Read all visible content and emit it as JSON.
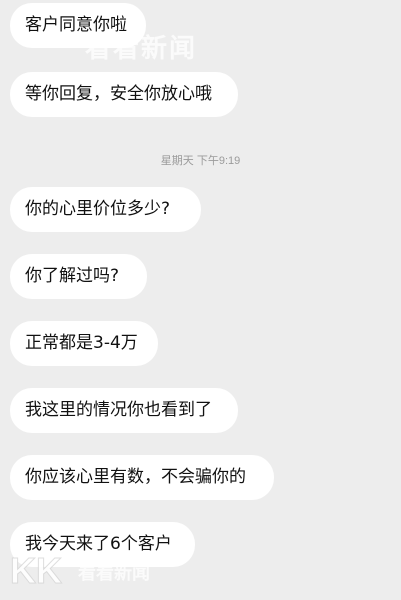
{
  "messages": [
    {
      "text": "客户同意你啦"
    },
    {
      "text": "等你回复，安全你放心哦"
    },
    {
      "text": "你的心里价位多少?"
    },
    {
      "text": "你了解过吗?"
    },
    {
      "text": "正常都是3-4万"
    },
    {
      "text": "我这里的情况你也看到了"
    },
    {
      "text": "你应该心里有数，不会骗你的"
    },
    {
      "text": "我今天来了6个客户"
    }
  ],
  "timestamp": "星期天 下午9:19",
  "watermarks": {
    "top_text": "看看新闻",
    "bottom_logo": "KK",
    "bottom_text": "看看新闻"
  }
}
